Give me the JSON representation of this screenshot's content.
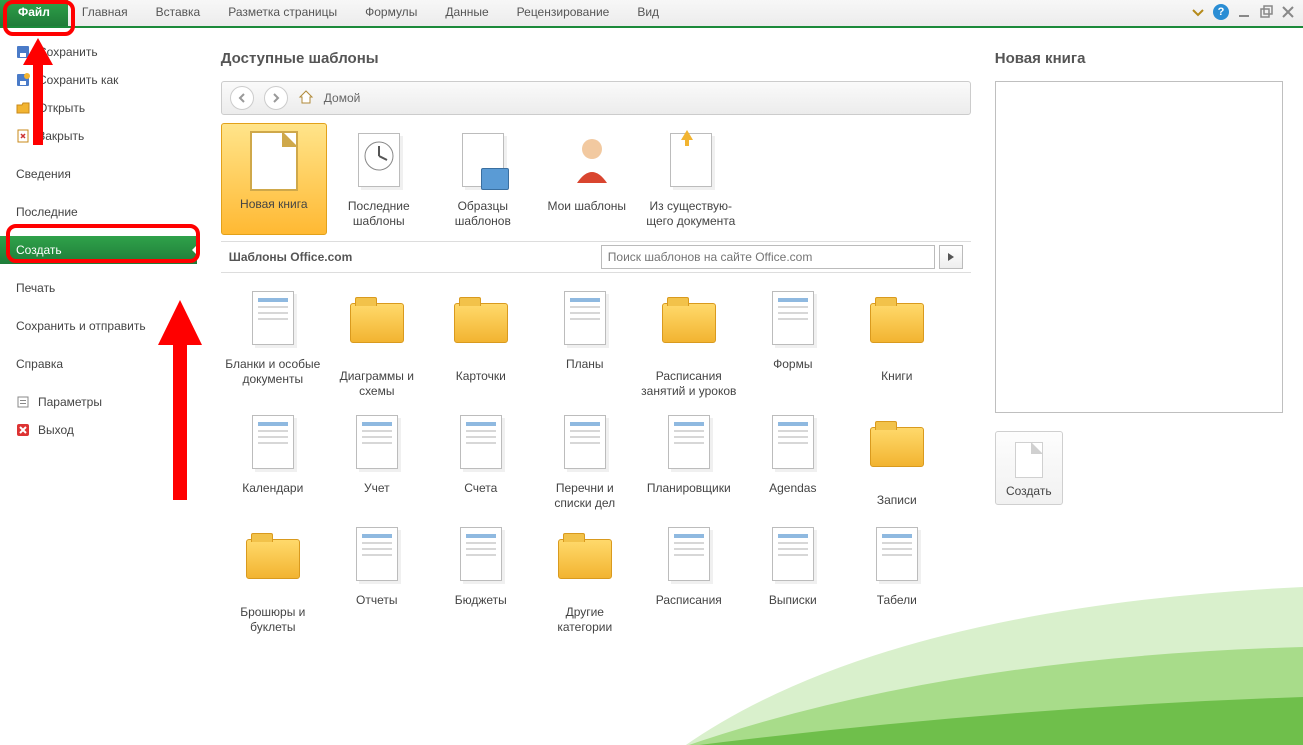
{
  "ribbon": {
    "tabs": [
      "Файл",
      "Главная",
      "Вставка",
      "Разметка страницы",
      "Формулы",
      "Данные",
      "Рецензирование",
      "Вид"
    ]
  },
  "sidebar": {
    "items": [
      {
        "label": "Сохранить"
      },
      {
        "label": "Сохранить как"
      },
      {
        "label": "Открыть"
      },
      {
        "label": "Закрыть"
      },
      {
        "label": "Сведения"
      },
      {
        "label": "Последние"
      },
      {
        "label": "Создать"
      },
      {
        "label": "Печать"
      },
      {
        "label": "Сохранить и отправить"
      },
      {
        "label": "Справка"
      },
      {
        "label": "Параметры"
      },
      {
        "label": "Выход"
      }
    ]
  },
  "content": {
    "heading": "Доступные шаблоны",
    "breadcrumb": "Домой",
    "top_templates": [
      {
        "label": "Новая книга"
      },
      {
        "label": "Последние шаблоны"
      },
      {
        "label": "Образцы шаблонов"
      },
      {
        "label": "Мои шаблоны"
      },
      {
        "label": "Из существую­щего документа"
      }
    ],
    "section_title": "Шаблоны Office.com",
    "search_placeholder": "Поиск шаблонов на сайте Office.com",
    "categories": [
      {
        "label": "Бланки и особые документы",
        "t": "doc"
      },
      {
        "label": "Диаграммы и схемы",
        "t": "folder"
      },
      {
        "label": "Карточки",
        "t": "folder"
      },
      {
        "label": "Планы",
        "t": "doc"
      },
      {
        "label": "Расписания занятий и уроков",
        "t": "folder"
      },
      {
        "label": "Формы",
        "t": "doc"
      },
      {
        "label": "Книги",
        "t": "folder"
      },
      {
        "label": "Календари",
        "t": "doc"
      },
      {
        "label": "Учет",
        "t": "doc"
      },
      {
        "label": "Счета",
        "t": "doc"
      },
      {
        "label": "Перечни и списки дел",
        "t": "doc"
      },
      {
        "label": "Планировщики",
        "t": "doc"
      },
      {
        "label": "Agendas",
        "t": "doc"
      },
      {
        "label": "Записи",
        "t": "folder"
      },
      {
        "label": "Брошюры и буклеты",
        "t": "folder"
      },
      {
        "label": "Отчеты",
        "t": "doc"
      },
      {
        "label": "Бюджеты",
        "t": "doc"
      },
      {
        "label": "Другие категории",
        "t": "folder"
      },
      {
        "label": "Расписания",
        "t": "doc"
      },
      {
        "label": "Выписки",
        "t": "doc"
      },
      {
        "label": "Табели",
        "t": "doc"
      }
    ]
  },
  "rpanel": {
    "title": "Новая книга",
    "button": "Создать"
  }
}
